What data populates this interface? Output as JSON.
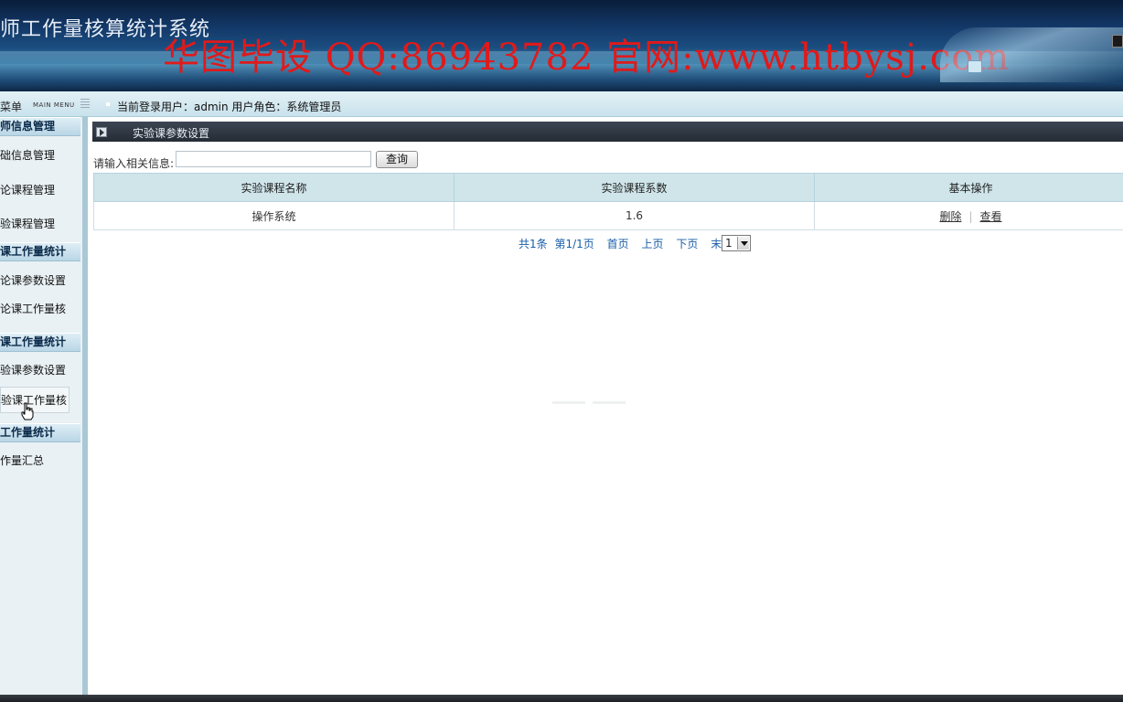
{
  "header": {
    "app_title": "师工作量核算统计系统",
    "watermark": "华图毕设 QQ:86943782 官网:www.htbysj.com"
  },
  "infobar": {
    "menu_title": "菜单",
    "menu_title_en": "MAIN MENU",
    "user_info": "当前登录用户：admin 用户角色：系统管理员"
  },
  "sidebar": {
    "groups": [
      {
        "label": "师信息管理",
        "items": [
          "础信息管理",
          "论课程管理",
          "验课程管理"
        ]
      },
      {
        "label": "课工作量统计",
        "items": [
          "论课参数设置",
          "论课工作量核"
        ]
      },
      {
        "label": "课工作量统计",
        "items": [
          "验课参数设置",
          "验课工作量核"
        ]
      },
      {
        "label": "工作量统计",
        "items": [
          "作量汇总"
        ]
      }
    ]
  },
  "panel": {
    "title": "实验课参数设置"
  },
  "search": {
    "label": "请输入相关信息:",
    "value": "",
    "button": "查询"
  },
  "table": {
    "columns": [
      "实验课程名称",
      "实验课程系数",
      "基本操作"
    ],
    "rows": [
      {
        "name": "操作系统",
        "coefficient": "1.6",
        "actions": [
          "删除",
          "查看"
        ]
      }
    ]
  },
  "pager": {
    "total": "共1条",
    "page_of": "第1/1页",
    "first": "首页",
    "prev": "上页",
    "next": "下页",
    "last": "末页",
    "selected_page": "1"
  }
}
